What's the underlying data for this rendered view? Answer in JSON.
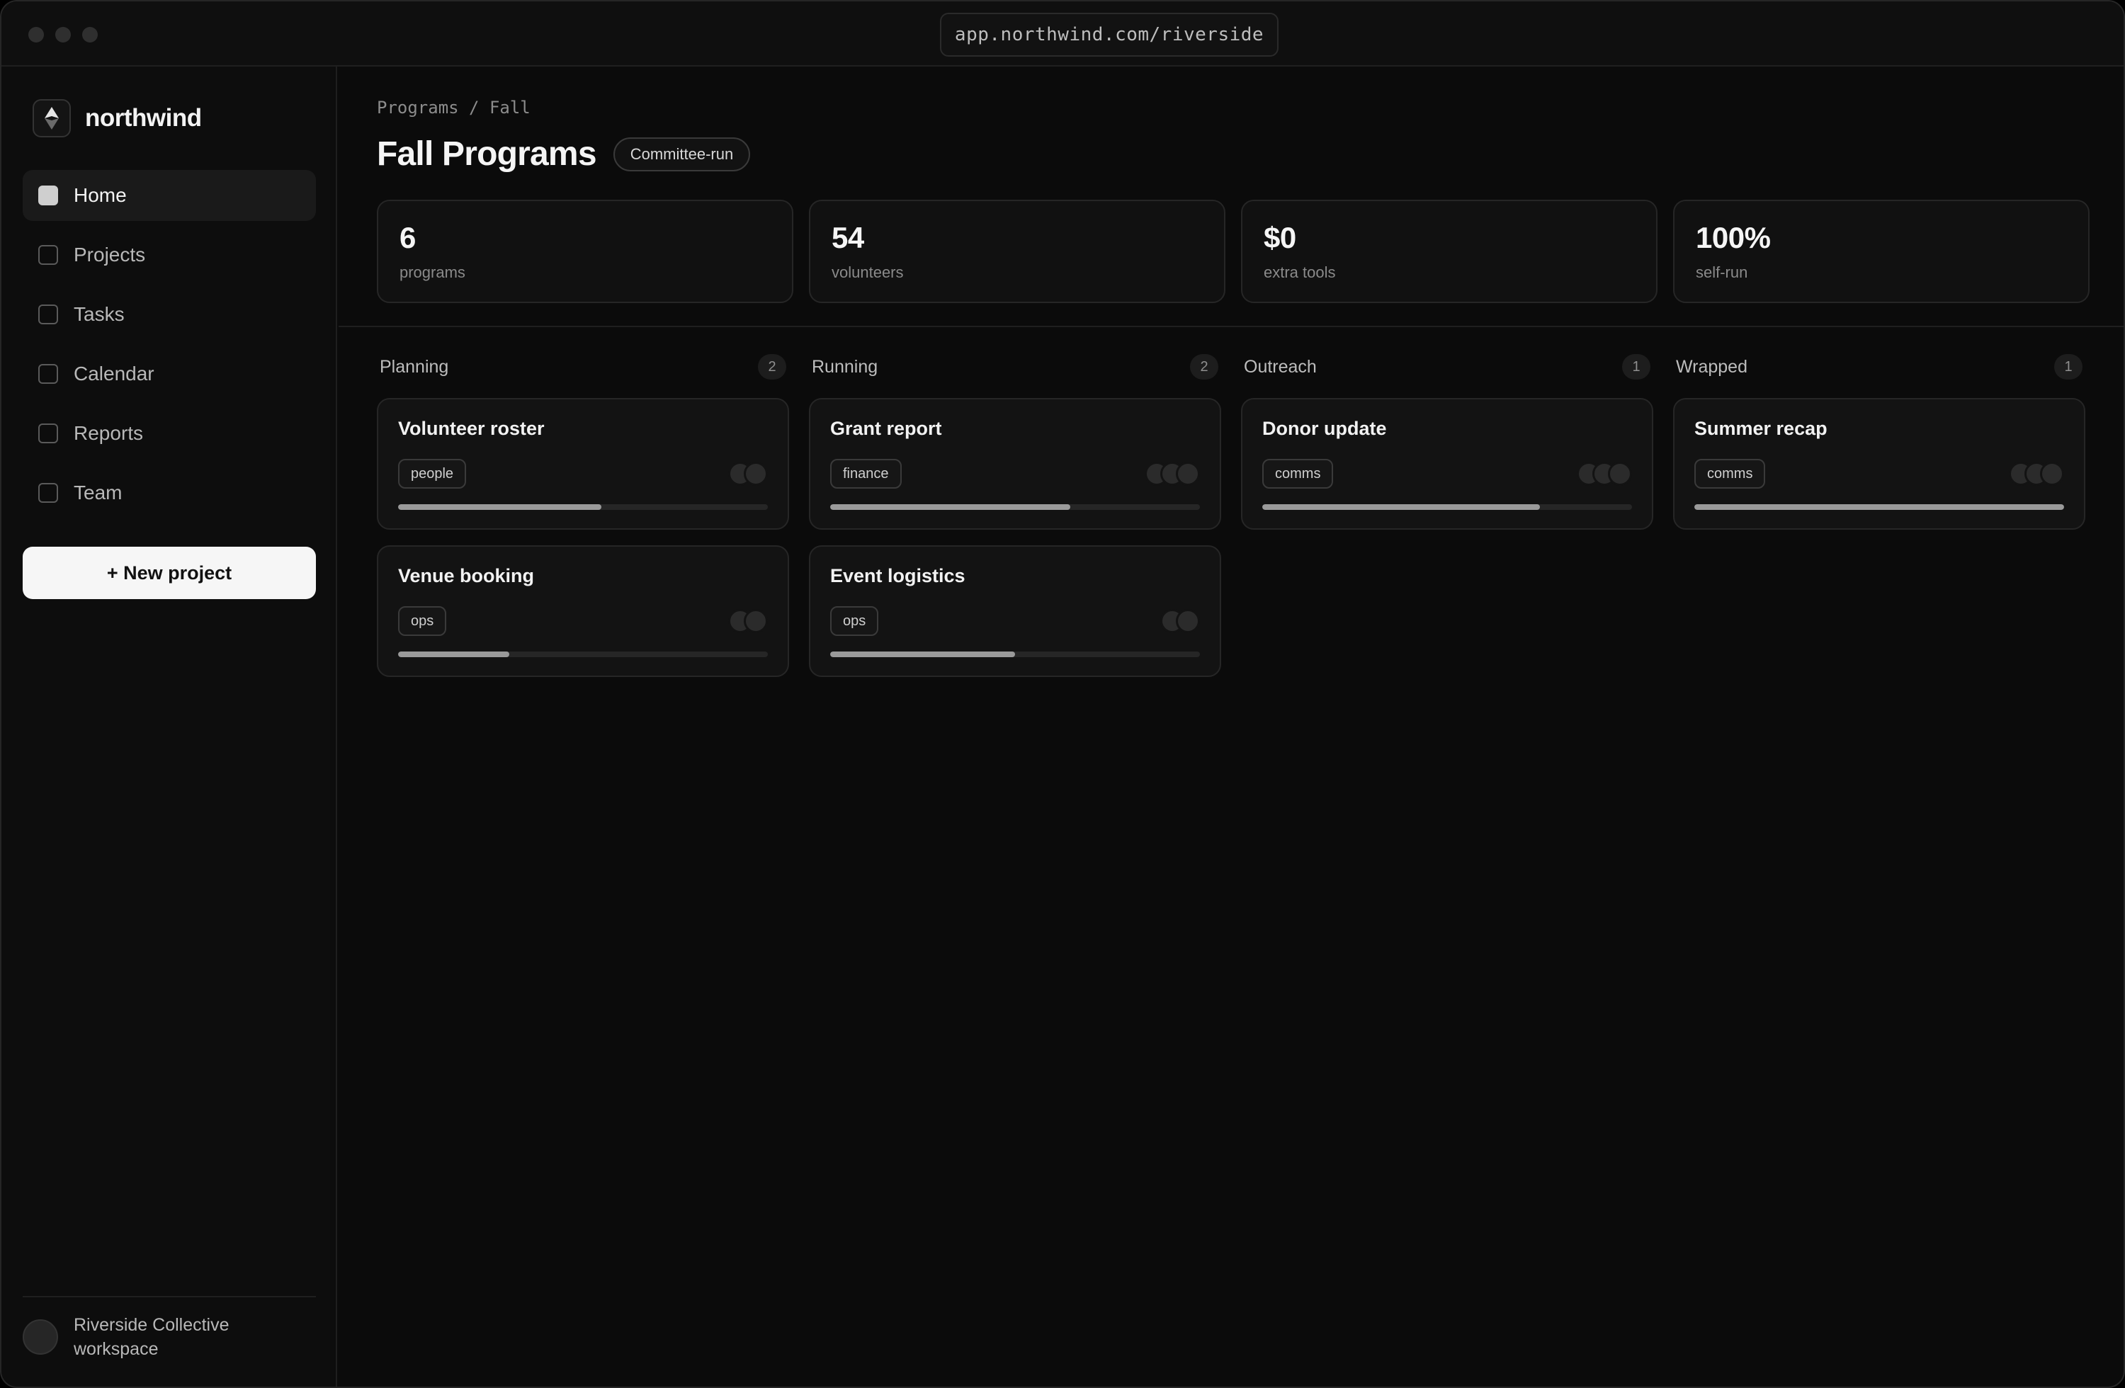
{
  "browser": {
    "url": "app.northwind.com/riverside"
  },
  "sidebar": {
    "brand": "northwind",
    "items": [
      {
        "label": "Home",
        "active": true,
        "icon": "home-icon"
      },
      {
        "label": "Projects",
        "active": false,
        "icon": "projects-icon"
      },
      {
        "label": "Tasks",
        "active": false,
        "icon": "tasks-icon"
      },
      {
        "label": "Calendar",
        "active": false,
        "icon": "calendar-icon"
      },
      {
        "label": "Reports",
        "active": false,
        "icon": "reports-icon"
      },
      {
        "label": "Team",
        "active": false,
        "icon": "team-icon"
      }
    ],
    "new_button": "+ New project",
    "workspace": {
      "name": "Riverside Collective",
      "type": "workspace"
    }
  },
  "header": {
    "breadcrumb": "Programs / Fall",
    "title": "Fall Programs",
    "badge": "Committee-run"
  },
  "stats": [
    {
      "value": "6",
      "label": "programs"
    },
    {
      "value": "54",
      "label": "volunteers"
    },
    {
      "value": "$0",
      "label": "extra tools"
    },
    {
      "value": "100%",
      "label": "self-run"
    }
  ],
  "columns": [
    {
      "title": "Planning",
      "count": "2",
      "cards": [
        {
          "title": "Volunteer roster",
          "tag": "people",
          "avatars": 2,
          "progress": 55
        },
        {
          "title": "Venue booking",
          "tag": "ops",
          "avatars": 2,
          "progress": 30
        }
      ]
    },
    {
      "title": "Running",
      "count": "2",
      "cards": [
        {
          "title": "Grant report",
          "tag": "finance",
          "avatars": 3,
          "progress": 65
        },
        {
          "title": "Event logistics",
          "tag": "ops",
          "avatars": 2,
          "progress": 50
        }
      ]
    },
    {
      "title": "Outreach",
      "count": "1",
      "cards": [
        {
          "title": "Donor update",
          "tag": "comms",
          "avatars": 3,
          "progress": 75
        }
      ]
    },
    {
      "title": "Wrapped",
      "count": "1",
      "cards": [
        {
          "title": "Summer recap",
          "tag": "comms",
          "avatars": 3,
          "progress": 100
        }
      ]
    }
  ],
  "colors": {
    "background": "#0b0b0b",
    "surface": "#131313",
    "border": "#262626",
    "progress_fill": "#9a9a9a",
    "button_bg": "#f6f6f6"
  }
}
